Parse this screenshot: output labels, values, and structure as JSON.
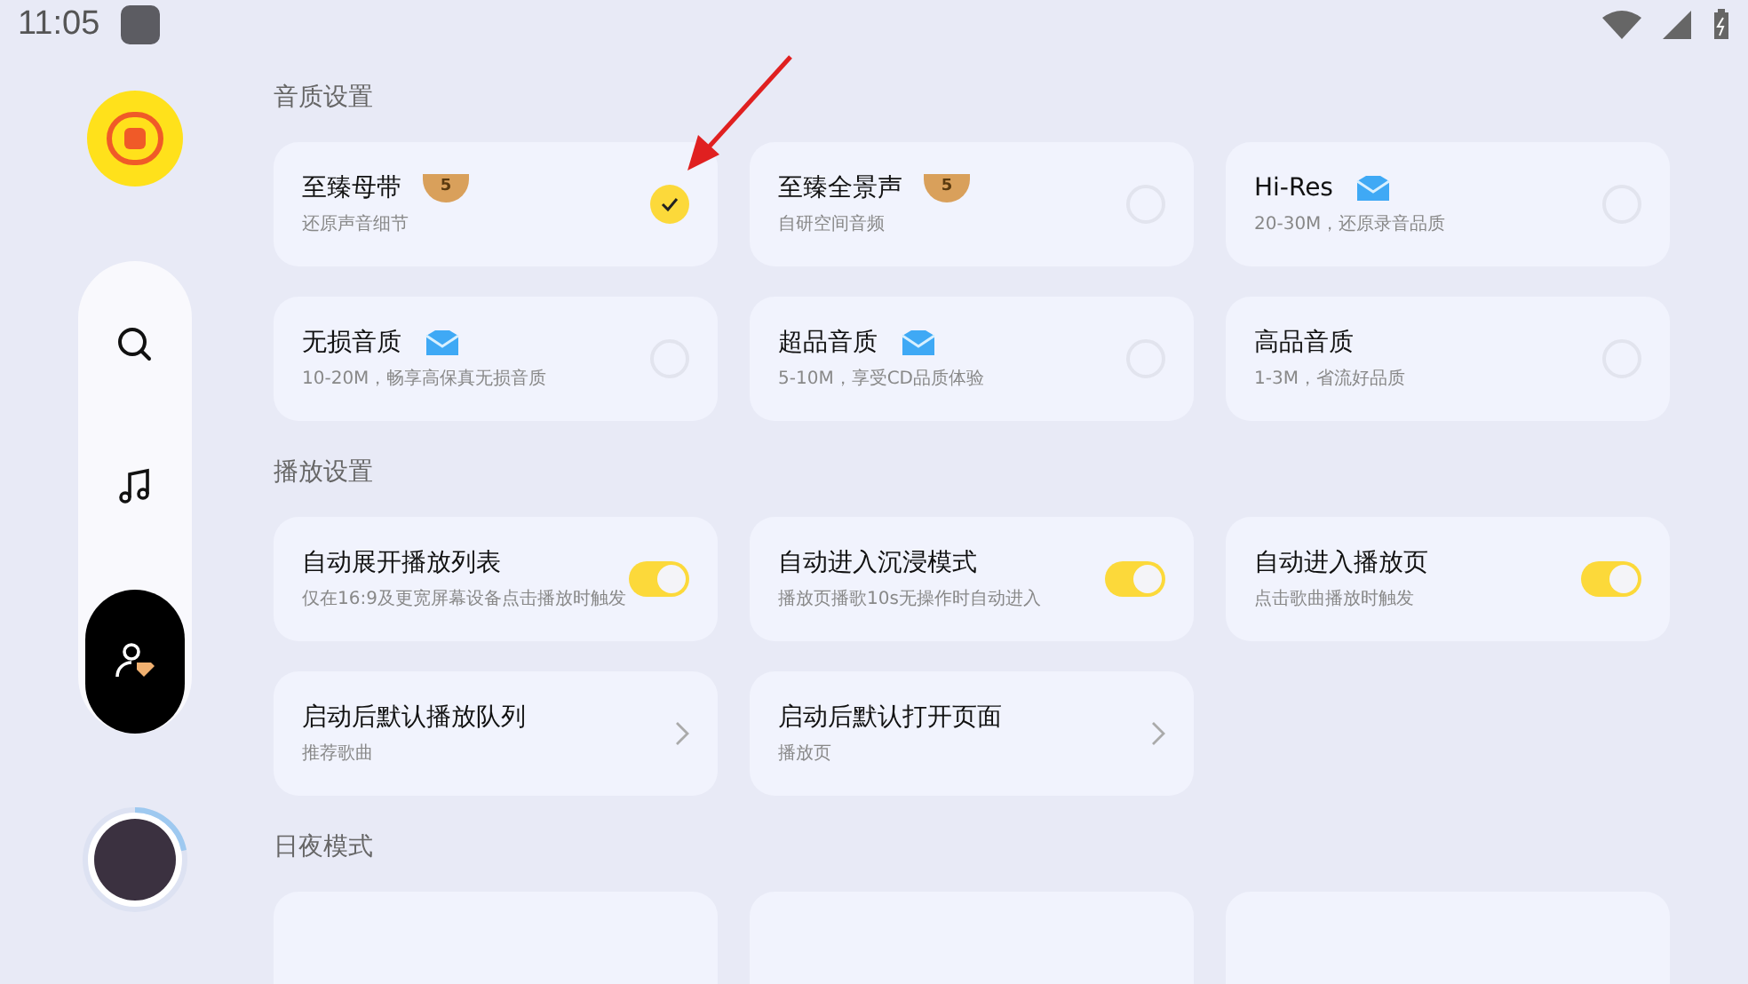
{
  "status_bar": {
    "time": "11:05"
  },
  "sidebar": {
    "items": [
      {
        "kind": "search",
        "selected": false
      },
      {
        "kind": "music",
        "selected": false
      },
      {
        "kind": "profile",
        "selected": true
      }
    ],
    "playback_progress": {
      "level": 0.22
    }
  },
  "sections": [
    {
      "title": "音质设置",
      "items": [
        {
          "kind": "radio",
          "title": "至臻母带",
          "badge": {
            "kind": "wing",
            "text": "5"
          },
          "subtitle": "还原声音细节",
          "selected": true
        },
        {
          "kind": "radio",
          "title": "至臻全景声",
          "badge": {
            "kind": "wing",
            "text": "5"
          },
          "subtitle": "自研空间音频",
          "selected": false
        },
        {
          "kind": "radio",
          "title": "Hi-Res",
          "badge": {
            "kind": "diamond"
          },
          "subtitle": "20-30M，还原录音品质",
          "selected": false
        },
        {
          "kind": "radio",
          "title": "无损音质",
          "badge": {
            "kind": "diamond"
          },
          "subtitle": "10-20M，畅享高保真无损音质",
          "selected": false
        },
        {
          "kind": "radio",
          "title": "超品音质",
          "badge": {
            "kind": "diamond"
          },
          "subtitle": "5-10M，享受CD品质体验",
          "selected": false
        },
        {
          "kind": "radio",
          "title": "高品音质",
          "subtitle": "1-3M，省流好品质",
          "selected": false
        }
      ]
    },
    {
      "title": "播放设置",
      "items": [
        {
          "kind": "toggle",
          "title": "自动展开播放列表",
          "subtitle": "仅在16:9及更宽屏幕设备点击播放时触发",
          "on": true
        },
        {
          "kind": "toggle",
          "title": "自动进入沉浸模式",
          "subtitle": "播放页播歌10s无操作时自动进入",
          "on": true
        },
        {
          "kind": "toggle",
          "title": "自动进入播放页",
          "subtitle": "点击歌曲播放时触发",
          "on": true
        },
        {
          "kind": "link",
          "title": "启动后默认播放队列",
          "subtitle": "推荐歌曲"
        },
        {
          "kind": "link",
          "title": "启动后默认打开页面",
          "subtitle": "播放页"
        }
      ]
    },
    {
      "title": "日夜模式",
      "items": [
        {
          "kind": "blank"
        },
        {
          "kind": "blank"
        },
        {
          "kind": "blank"
        }
      ]
    }
  ]
}
